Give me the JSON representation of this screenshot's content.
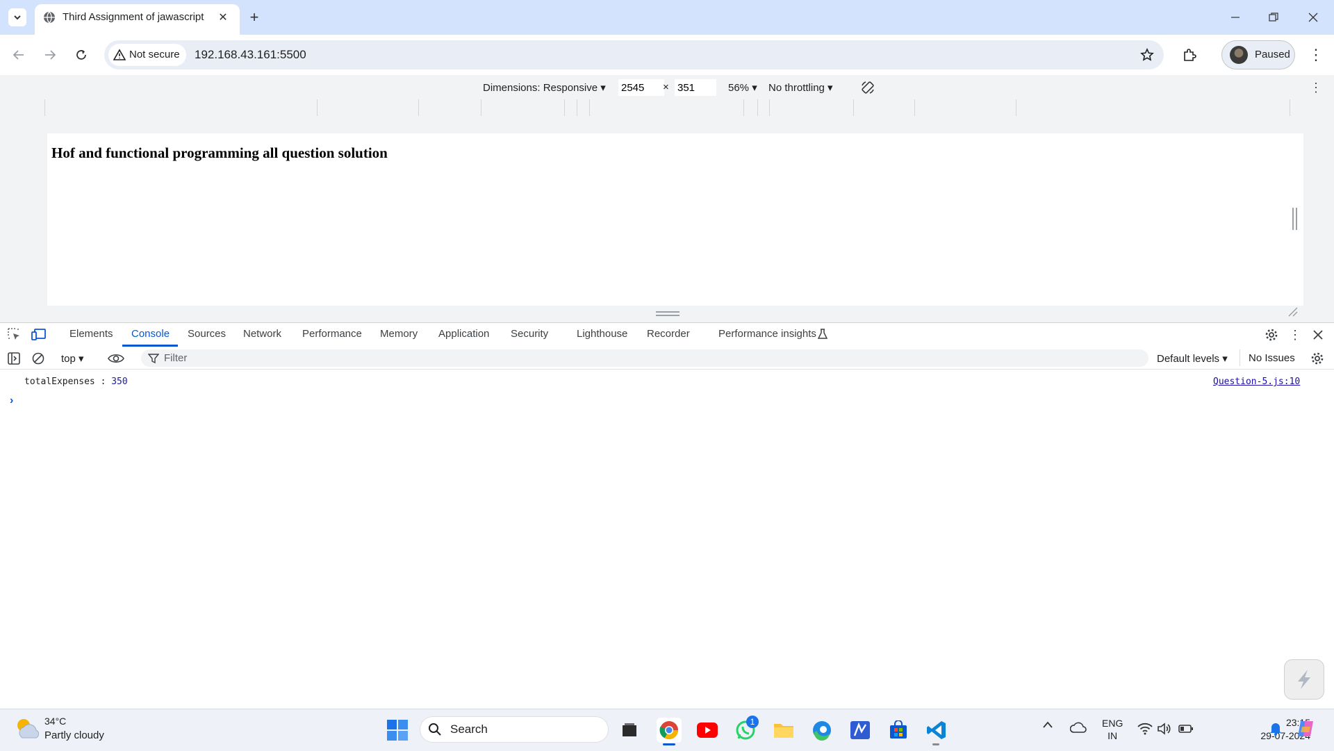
{
  "browser": {
    "tab_title": "Third Assignment of jawascript",
    "new_tab_label": "+",
    "security_label": "Not secure",
    "url": "192.168.43.161:5500",
    "profile_label": "Paused"
  },
  "device_toolbar": {
    "dimensions_label": "Dimensions: Responsive ▾",
    "width": "2545",
    "times": "×",
    "height": "351",
    "zoom": "56% ▾",
    "throttling": "No throttling ▾"
  },
  "page": {
    "heading": "Hof and functional programming all question solution"
  },
  "devtools": {
    "tabs": [
      "Elements",
      "Console",
      "Sources",
      "Network",
      "Performance",
      "Memory",
      "Application",
      "Security",
      "Lighthouse",
      "Recorder",
      "Performance insights"
    ],
    "active_tab": "Console",
    "context": "top ▾",
    "filter_placeholder": "Filter",
    "levels": "Default levels ▾",
    "issues": "No Issues",
    "log": {
      "label": "totalExpenses : ",
      "value": "350",
      "source": "Question-5.js:10"
    },
    "prompt": "›"
  },
  "taskbar": {
    "temperature": "34°C",
    "condition": "Partly cloudy",
    "search_label": "Search",
    "whatsapp_badge": "1",
    "lang_line1": "ENG",
    "lang_line2": "IN",
    "time": "23:15",
    "date": "29-07-2024"
  },
  "colors": {
    "tabstrip": "#d3e3fd",
    "accent": "#0b57d0",
    "console_value": "#1a1aa6"
  }
}
